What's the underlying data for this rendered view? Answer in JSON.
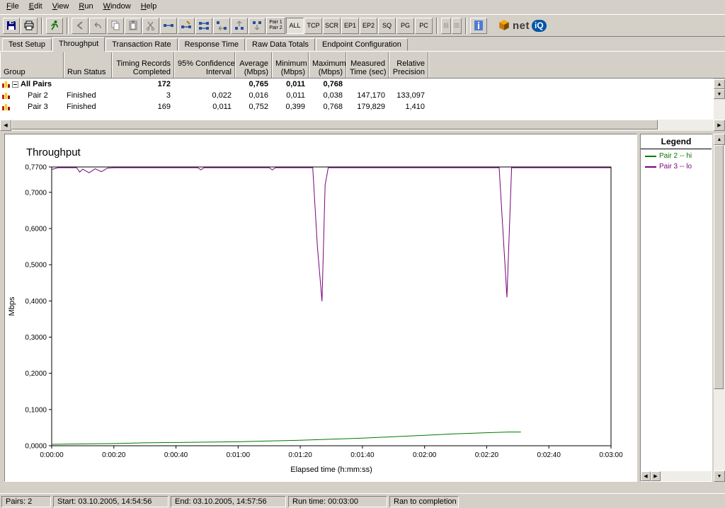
{
  "window": {
    "bg": "#d4d0c8"
  },
  "menu": {
    "items": [
      "File",
      "Edit",
      "View",
      "Run",
      "Window",
      "Help"
    ]
  },
  "toolbar": {
    "filters": [
      "ALL",
      "TCP",
      "SCR",
      "EP1",
      "EP2",
      "SQ",
      "PG",
      "PC"
    ],
    "active_filter": "ALL",
    "pair_button": {
      "line1": "Pair 1",
      "line2": "Pair 2"
    },
    "brand": {
      "net": "net",
      "iq": "iQ"
    }
  },
  "tabs": {
    "items": [
      "Test Setup",
      "Throughput",
      "Transaction Rate",
      "Response Time",
      "Raw Data Totals",
      "Endpoint Configuration"
    ],
    "active_index": 1
  },
  "table": {
    "columns": [
      {
        "line1": "",
        "line2": "Group"
      },
      {
        "line1": "",
        "line2": "Run Status"
      },
      {
        "line1": "Timing Records",
        "line2": "Completed"
      },
      {
        "line1": "95% Confidence",
        "line2": "Interval"
      },
      {
        "line1": "Average",
        "line2": "(Mbps)"
      },
      {
        "line1": "Minimum",
        "line2": "(Mbps)"
      },
      {
        "line1": "Maximum",
        "line2": "(Mbps)"
      },
      {
        "line1": "Measured",
        "line2": "Time (sec)"
      },
      {
        "line1": "Relative",
        "line2": "Precision"
      }
    ],
    "rows": [
      {
        "group": "All Pairs",
        "run_status": "",
        "timing_records": "172",
        "confidence": "",
        "average": "0,765",
        "minimum": "0,011",
        "maximum": "0,768",
        "measured_time": "",
        "precision": ""
      },
      {
        "group": "Pair 2",
        "run_status": "Finished",
        "timing_records": "3",
        "confidence": "0,022",
        "average": "0,016",
        "minimum": "0,011",
        "maximum": "0,038",
        "measured_time": "147,170",
        "precision": "133,097"
      },
      {
        "group": "Pair 3",
        "run_status": "Finished",
        "timing_records": "169",
        "confidence": "0,011",
        "average": "0,752",
        "minimum": "0,399",
        "maximum": "0,768",
        "measured_time": "179,829",
        "precision": "1,410"
      }
    ]
  },
  "chart_data": {
    "type": "line",
    "title": "Throughput",
    "xlabel": "Elapsed time (h:mm:ss)",
    "ylabel": "Mbps",
    "xlim": [
      0,
      180
    ],
    "ylim": [
      0,
      0.77
    ],
    "grid": false,
    "legend_position": "right-panel",
    "ytick_values": [
      0,
      0.1,
      0.2,
      0.3,
      0.4,
      0.5,
      0.6,
      0.7,
      0.77
    ],
    "ytick_labels": [
      "0,0000",
      "0,1000",
      "0,2000",
      "0,3000",
      "0,4000",
      "0,5000",
      "0,6000",
      "0,7000",
      "0,7700"
    ],
    "xtick_values": [
      0,
      20,
      40,
      60,
      80,
      100,
      120,
      140,
      160,
      180
    ],
    "xtick_labels": [
      "0:00:00",
      "0:00:20",
      "0:00:40",
      "0:01:00",
      "0:01:20",
      "0:01:40",
      "0:02:00",
      "0:02:20",
      "0:02:40",
      "0:03:00"
    ],
    "series": [
      {
        "name": "Pair 2 -- hi",
        "color": "#007800",
        "points": [
          [
            0,
            0.004
          ],
          [
            10,
            0.005
          ],
          [
            20,
            0.006
          ],
          [
            30,
            0.008
          ],
          [
            40,
            0.009
          ],
          [
            50,
            0.01
          ],
          [
            60,
            0.011
          ],
          [
            70,
            0.013
          ],
          [
            80,
            0.015
          ],
          [
            90,
            0.018
          ],
          [
            100,
            0.021
          ],
          [
            110,
            0.025
          ],
          [
            120,
            0.029
          ],
          [
            130,
            0.033
          ],
          [
            140,
            0.036
          ],
          [
            147,
            0.038
          ],
          [
            151,
            0.038
          ]
        ]
      },
      {
        "name": "Pair 3 -- lo",
        "color": "#7a007a",
        "points": [
          [
            0,
            0.763
          ],
          [
            2,
            0.768
          ],
          [
            8,
            0.768
          ],
          [
            9,
            0.756
          ],
          [
            10,
            0.764
          ],
          [
            12,
            0.754
          ],
          [
            14,
            0.765
          ],
          [
            16,
            0.757
          ],
          [
            18,
            0.767
          ],
          [
            20,
            0.768
          ],
          [
            47,
            0.768
          ],
          [
            48,
            0.762
          ],
          [
            49,
            0.768
          ],
          [
            70,
            0.768
          ],
          [
            71,
            0.762
          ],
          [
            72,
            0.768
          ],
          [
            84,
            0.768
          ],
          [
            85.5,
            0.55
          ],
          [
            87,
            0.399
          ],
          [
            88,
            0.72
          ],
          [
            89,
            0.768
          ],
          [
            144,
            0.768
          ],
          [
            146.5,
            0.41
          ],
          [
            148,
            0.768
          ],
          [
            180,
            0.768
          ]
        ]
      }
    ]
  },
  "legend": {
    "title": "Legend",
    "entries": [
      {
        "label": "Pair 2 -- hi",
        "color": "#007800"
      },
      {
        "label": "Pair 3 -- lo",
        "color": "#7a007a"
      }
    ]
  },
  "statusbar": {
    "fields": [
      "Pairs: 2",
      "Start: 03.10.2005, 14:54:56",
      "End: 03.10.2005, 14:57:56",
      "Run time: 00:03:00",
      "Ran to completion"
    ]
  }
}
